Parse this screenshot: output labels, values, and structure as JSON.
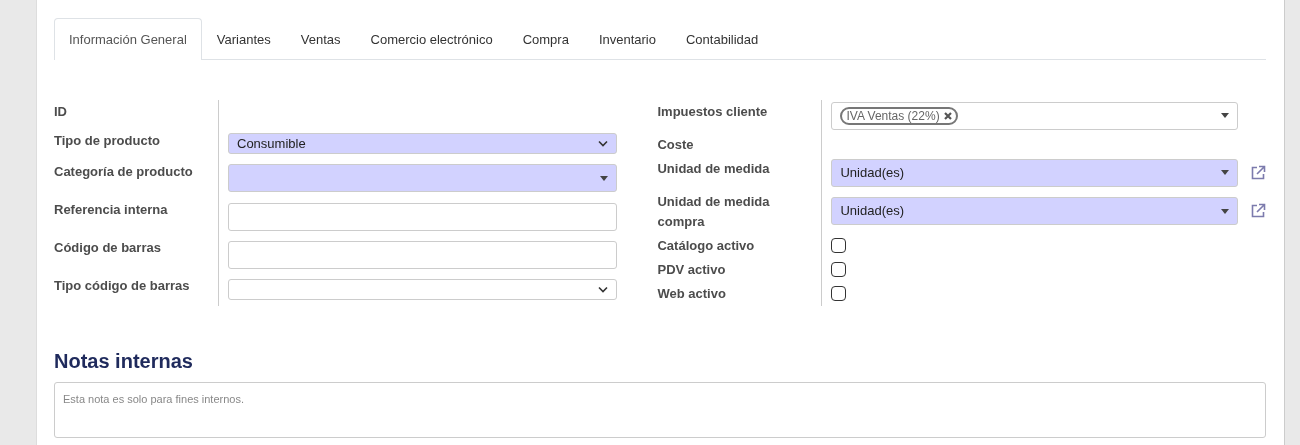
{
  "tabs": [
    {
      "label": "Información General",
      "selected": true
    },
    {
      "label": "Variantes",
      "selected": false
    },
    {
      "label": "Ventas",
      "selected": false
    },
    {
      "label": "Comercio electrónico",
      "selected": false
    },
    {
      "label": "Compra",
      "selected": false
    },
    {
      "label": "Inventario",
      "selected": false
    },
    {
      "label": "Contabilidad",
      "selected": false
    }
  ],
  "left_fields": [
    {
      "label": "ID",
      "kind": "empty"
    },
    {
      "label": "Tipo de producto",
      "kind": "select",
      "value": "Consumible",
      "required": true
    },
    {
      "label": "Categoría de producto",
      "kind": "many2one",
      "required": true
    },
    {
      "label": "Referencia interna",
      "kind": "text",
      "required": false
    },
    {
      "label": "Código de barras",
      "kind": "text",
      "required": false
    },
    {
      "label": "Tipo código de barras",
      "kind": "select",
      "required": false
    }
  ],
  "right_fields": [
    {
      "label": "Impuestos cliente",
      "kind": "tags",
      "tags": [
        "IVA Ventas (22%)"
      ],
      "required": false
    },
    {
      "label": "Coste",
      "kind": "empty"
    },
    {
      "label": "Unidad de medida",
      "kind": "many2one",
      "value": "Unidad(es)",
      "required": true,
      "external_link": true
    },
    {
      "label": "Unidad de medida compra",
      "kind": "many2one",
      "value": "Unidad(es)",
      "required": true,
      "external_link": true
    },
    {
      "label": "Catálogo activo",
      "kind": "checkbox",
      "checked": false
    },
    {
      "label": "PDV activo",
      "kind": "checkbox",
      "checked": false
    },
    {
      "label": "Web activo",
      "kind": "checkbox",
      "checked": false
    }
  ],
  "notes": {
    "title": "Notas internas",
    "placeholder": "Esta nota es solo para fines internos."
  }
}
